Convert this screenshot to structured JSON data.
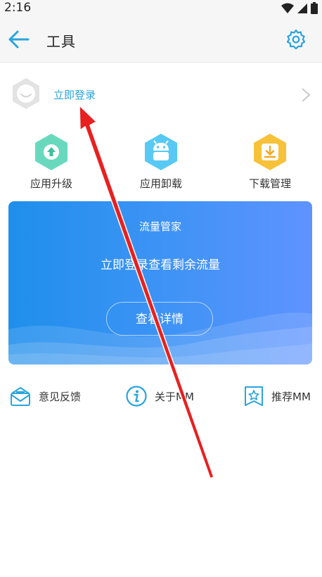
{
  "status_bar": {
    "time": "2:16"
  },
  "app_bar": {
    "title": "工具"
  },
  "login": {
    "label": "立即登录"
  },
  "tools": [
    {
      "label": "应用升级",
      "icon": "upload-arrow-icon",
      "color": "#69d9bd"
    },
    {
      "label": "应用卸载",
      "icon": "android-icon",
      "color": "#58c9f5"
    },
    {
      "label": "下载管理",
      "icon": "download-icon",
      "color": "#f7c23a"
    }
  ],
  "traffic_card": {
    "title": "流量管家",
    "subtitle": "立即登录查看剩余流量",
    "button_label": "查看详情"
  },
  "links": [
    {
      "label": "意见反馈",
      "icon": "feedback-envelope-icon"
    },
    {
      "label": "关于MM",
      "icon": "info-icon"
    },
    {
      "label": "推荐MM",
      "icon": "recommend-star-icon"
    }
  ],
  "colors": {
    "accent": "#2aa4dc",
    "card_start": "#1f8fec",
    "card_end": "#5f93ff",
    "annotation_arrow": "#e82020"
  }
}
